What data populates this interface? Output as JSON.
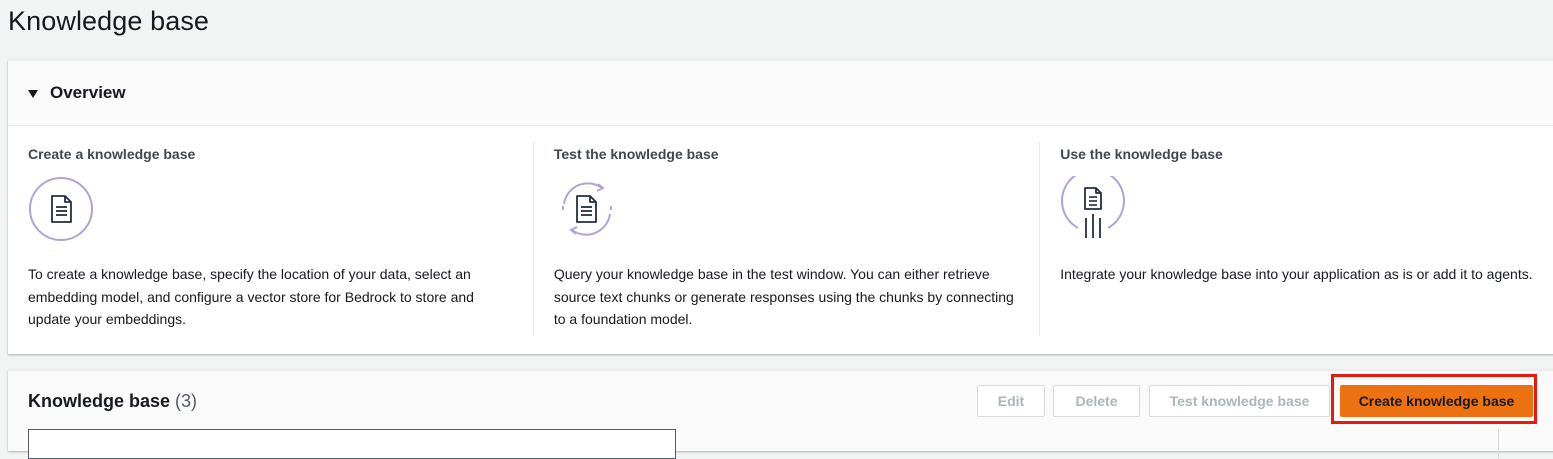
{
  "page": {
    "title": "Knowledge base"
  },
  "overview": {
    "title": "Overview",
    "columns": [
      {
        "heading": "Create a knowledge base",
        "icon": "document-icon",
        "description": "To create a knowledge base, specify the location of your data, select an embedding model, and configure a vector store for Bedrock to store and update your embeddings."
      },
      {
        "heading": "Test the knowledge base",
        "icon": "document-refresh-icon",
        "description": "Query your knowledge base in the test window. You can either retrieve source text chunks or generate responses using the chunks by connecting to a foundation model."
      },
      {
        "heading": "Use the knowledge base",
        "icon": "document-integrate-icon",
        "description": "Integrate your knowledge base into your application as is or add it to agents."
      }
    ]
  },
  "kb_table": {
    "title": "Knowledge base",
    "count": "(3)",
    "buttons": {
      "edit": "Edit",
      "delete": "Delete",
      "test": "Test knowledge base",
      "create": "Create knowledge base"
    }
  },
  "colors": {
    "primary": "#ec7211",
    "highlight": "#e8190e",
    "icon_purple": "#b3a2d8",
    "icon_dark": "#232f3e"
  }
}
